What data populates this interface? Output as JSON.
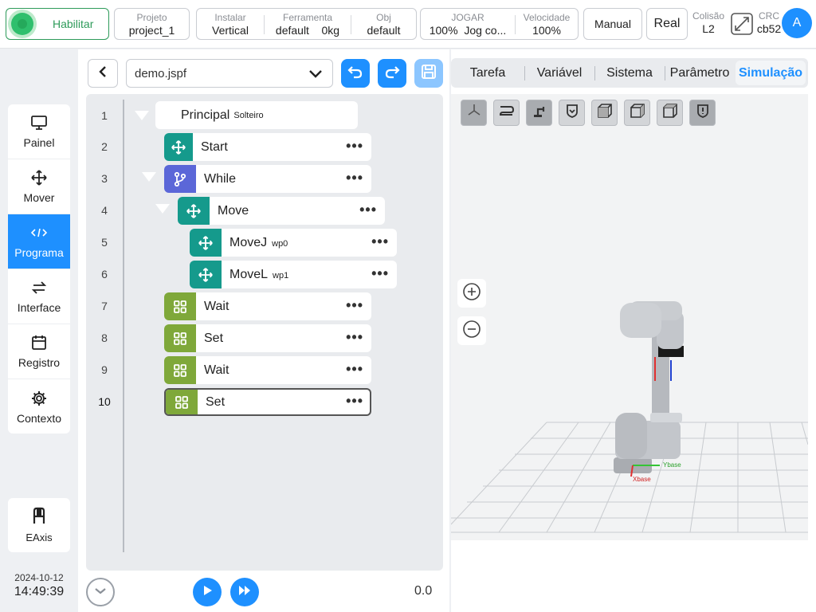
{
  "topbar": {
    "enable_label": "Habilitar",
    "project_caption": "Projeto",
    "project_value": "project_1",
    "install_caption": "Instalar",
    "install_value": "Vertical",
    "tool_caption": "Ferramenta",
    "tool_value": "default",
    "tool_load": "0kg",
    "obj_caption": "Obj",
    "obj_value": "default",
    "jog_caption": "JOGAR",
    "jog_value": "100%",
    "jog_mode": "Jog co...",
    "speed_caption": "Velocidade",
    "speed_value": "100%",
    "manual_label": "Manual",
    "real_label": "Real",
    "collision_caption": "Colisão",
    "collision_value": "L2",
    "crc_caption": "CRC",
    "crc_value": "cb52",
    "avatar_letter": "A",
    "enable_color": "#2fbf6d"
  },
  "nav": {
    "items": [
      {
        "label": "Painel",
        "icon": "monitor-icon"
      },
      {
        "label": "Mover",
        "icon": "move-arrows-icon"
      },
      {
        "label": "Programa",
        "icon": "code-icon"
      },
      {
        "label": "Interface",
        "icon": "swap-icon"
      },
      {
        "label": "Registro",
        "icon": "calendar-icon"
      },
      {
        "label": "Contexto",
        "icon": "gear-icon"
      }
    ],
    "active": "Programa",
    "eaxis_label": "EAxis",
    "date": "2024-10-12",
    "time": "14:49:39"
  },
  "program": {
    "file_name": "demo.jspf",
    "root_label": "Principal",
    "root_sub": "Solteiro",
    "line_numbers": [
      "1",
      "2",
      "3",
      "4",
      "5",
      "6",
      "7",
      "8",
      "9",
      "10"
    ],
    "nodes": [
      {
        "label": "Start",
        "sub": ""
      },
      {
        "label": "While",
        "sub": ""
      },
      {
        "label": "Move",
        "sub": ""
      },
      {
        "label": "MoveJ",
        "sub": "wp0"
      },
      {
        "label": "MoveL",
        "sub": "wp1"
      },
      {
        "label": "Wait",
        "sub": ""
      },
      {
        "label": "Set",
        "sub": ""
      },
      {
        "label": "Wait",
        "sub": ""
      },
      {
        "label": "Set",
        "sub": ""
      }
    ],
    "selected_line": "10",
    "counter": "0.0",
    "colors": {
      "move": "#159a8c",
      "while": "#5b67d8",
      "io": "#7fa83a",
      "accent": "#1e90ff"
    }
  },
  "right": {
    "tabs": [
      "Tarefa",
      "Variável",
      "Sistema",
      "Parâmetro",
      "Simulação"
    ],
    "active_tab": "Simulação",
    "axis_labels": {
      "x": "Xbase",
      "y": "Ybase"
    }
  }
}
